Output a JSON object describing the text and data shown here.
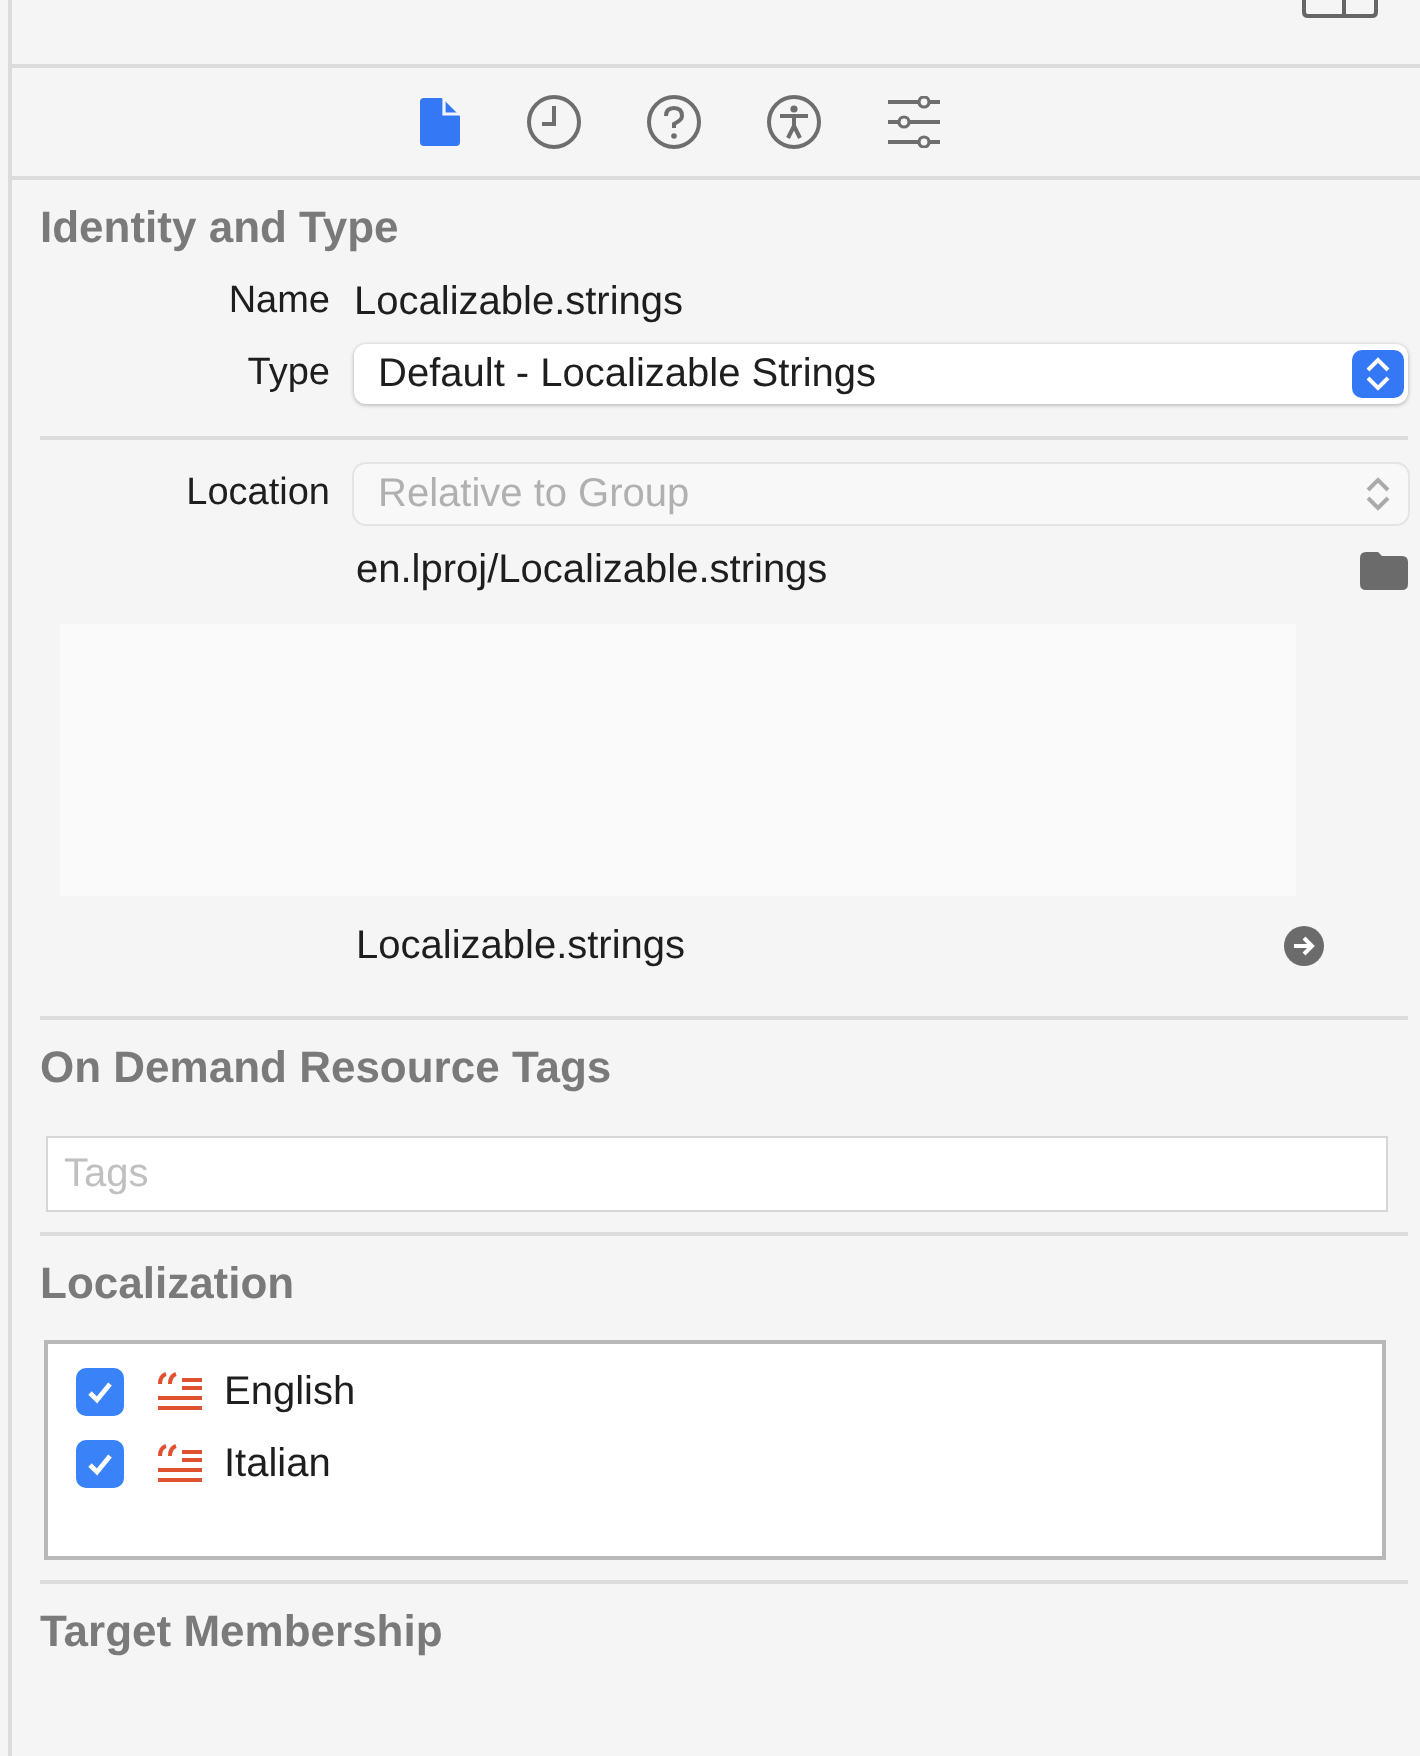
{
  "inspector_tabs": [
    {
      "kind": "file",
      "selected": true
    },
    {
      "kind": "history",
      "selected": false
    },
    {
      "kind": "help",
      "selected": false
    },
    {
      "kind": "accessibility",
      "selected": false
    },
    {
      "kind": "attributes",
      "selected": false
    }
  ],
  "identity": {
    "title": "Identity and Type",
    "name": {
      "label": "Name",
      "value": "Localizable.strings"
    },
    "type": {
      "label": "Type",
      "value": "Default - Localizable Strings",
      "disabled": false
    },
    "location": {
      "label": "Location",
      "value": "Relative to Group",
      "disabled": true
    },
    "relative_path": "en.lproj/Localizable.strings",
    "full_path": "Localizable.strings"
  },
  "on_demand": {
    "title": "On Demand Resource Tags",
    "tags_field": {
      "placeholder": "Tags"
    }
  },
  "localization": {
    "title": "Localization",
    "languages": [
      {
        "name": "English",
        "checked": true
      },
      {
        "name": "Italian",
        "checked": true
      }
    ]
  },
  "target_membership": {
    "title": "Target Membership"
  }
}
